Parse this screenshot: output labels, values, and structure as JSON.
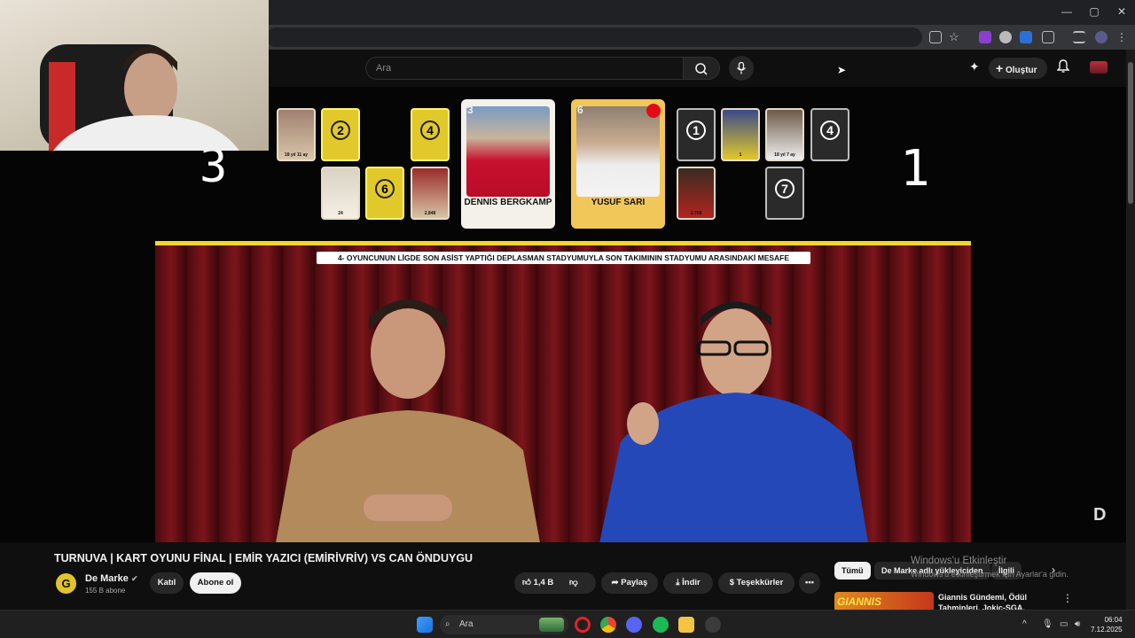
{
  "browser": {
    "window_controls": [
      "—",
      "▢",
      "✕"
    ]
  },
  "header": {
    "search_placeholder": "Ara",
    "create_label": "Oluştur",
    "search_icon": "search-icon",
    "mic_icon": "mic-icon",
    "bell_icon": "bell-icon"
  },
  "video": {
    "score_left": "3",
    "score_right": "1",
    "question": "4- OYUNCUNUN LİGDE SON ASİST YAPTIĞI DEPLASMAN STADYUMUYLA SON TAKIMININ STADYUMU ARASINDAKİ MESAFE",
    "left_cards": [
      {
        "label": "2"
      },
      {
        "label": "4"
      },
      {
        "label": "6"
      }
    ],
    "small_caps": {
      "c1": "18 yıl 11 ay",
      "c2": "24",
      "c3": "2.848",
      "c4": "1",
      "c5": "18 yıl 7 ay",
      "c6": "2.758"
    },
    "big_cards": [
      {
        "number": "3",
        "name": "DENNIS BERGKAMP"
      },
      {
        "number": "6",
        "name": "YUSUF SARI"
      }
    ],
    "right_cards": [
      {
        "label": "1"
      },
      {
        "label": "4"
      },
      {
        "label": "7"
      }
    ],
    "corner_logo": "D"
  },
  "info": {
    "title": "TURNUVA | KART OYUNU FİNAL | EMİR YAZICI (EMİRİVRİV) VS CAN ÖNDUYGU",
    "channel_name": "De Marke",
    "channel_avatar": "G",
    "subscribers": "155 B abone",
    "join_label": "Katıl",
    "subscribe_label": "Abone ol",
    "like_count": "1,4 B",
    "share_label": "Paylaş",
    "download_label": "İndir",
    "thanks_label": "Teşekkürler",
    "more_label": "•••"
  },
  "side": {
    "chips": [
      "Tümü",
      "De Marke adlı yükleyiciden",
      "İlgili"
    ],
    "rec_thumb_text": "GIANNIS",
    "rec_title": "Giannis Gündemi, Ödül Tahminleri, Jokic-SGA, LeBron",
    "windows_activate": "Windows'u Etkinleştir",
    "windows_activate_sub": "Windows'u etkinleştirmek için Ayarlar'a gidin."
  },
  "taskbar": {
    "search_label": "Ara",
    "time": "06:04",
    "date": "7.12.2025"
  },
  "colors": {
    "accent_yellow": "#f3d62a",
    "yt_bg": "#0f0f0f"
  }
}
